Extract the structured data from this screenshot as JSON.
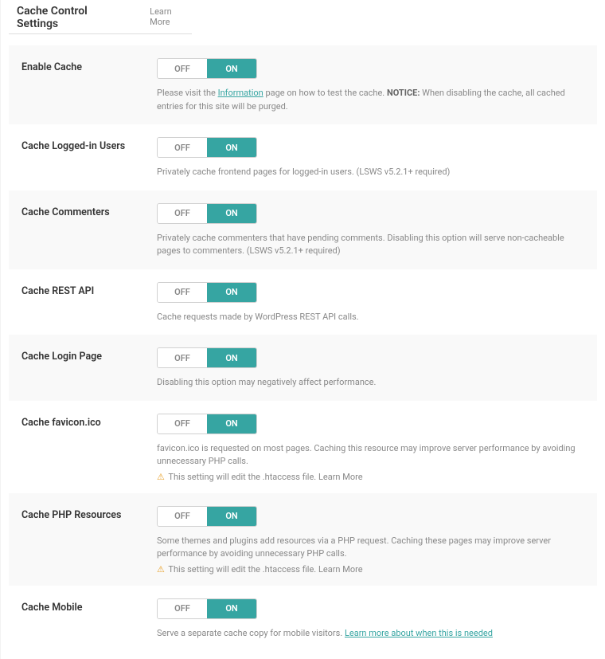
{
  "header": {
    "title": "Cache Control Settings",
    "learn_more": "Learn More"
  },
  "toggle": {
    "off": "OFF",
    "on": "ON"
  },
  "htaccess_warning": "This setting will edit the .htaccess file.",
  "learn_more_link": "Learn More",
  "rows": [
    {
      "label": "Enable Cache",
      "desc_prefix": "Please visit the ",
      "desc_link": "Information",
      "desc_mid": " page on how to test the cache. ",
      "desc_bold": "NOTICE:",
      "desc_suffix": " When disabling the cache, all cached entries for this site will be purged."
    },
    {
      "label": "Cache Logged-in Users",
      "desc": "Privately cache frontend pages for logged-in users. (LSWS v5.2.1+ required)"
    },
    {
      "label": "Cache Commenters",
      "desc": "Privately cache commenters that have pending comments. Disabling this option will serve non-cacheable pages to commenters. (LSWS v5.2.1+ required)"
    },
    {
      "label": "Cache REST API",
      "desc": "Cache requests made by WordPress REST API calls."
    },
    {
      "label": "Cache Login Page",
      "desc": "Disabling this option may negatively affect performance."
    },
    {
      "label": "Cache favicon.ico",
      "desc": "favicon.ico is requested on most pages. Caching this resource may improve server performance by avoiding unnecessary PHP calls."
    },
    {
      "label": "Cache PHP Resources",
      "desc": "Some themes and plugins add resources via a PHP request. Caching these pages may improve server performance by avoiding unnecessary PHP calls."
    },
    {
      "label": "Cache Mobile",
      "desc_prefix": "Serve a separate cache copy for mobile visitors. ",
      "desc_link": "Learn more about when this is needed"
    }
  ]
}
